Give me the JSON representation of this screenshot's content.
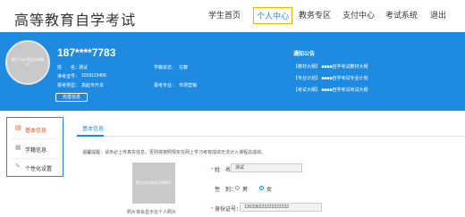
{
  "header": {
    "title": "高等教育自学考试",
    "nav": [
      "学生首页",
      "个人中心",
      "教务专区",
      "支付中心",
      "考试系统",
      "退出"
    ],
    "active_nav": "个人中心"
  },
  "profile": {
    "avatar_placeholder": "图片为必须显示的照片",
    "phone": "187****7783",
    "name_label": "姓　　名：",
    "name_value": "测试",
    "status_label": "学籍状态：",
    "status_value": "在籍",
    "permit_label": "准考证号：",
    "permit_value": "2018123456",
    "level_label": "报考类型：",
    "level_value": "高起专升本",
    "major_label": "报考专业：",
    "major_value": "市场营销",
    "perfect_button": "完善信息"
  },
  "notice": {
    "title": "通知公告",
    "items": [
      "【教材大纲】 ■■■■自学考试教材大纲",
      "【专业计划】 ■■■■自学考试专业计划",
      "【考试大纲】 ■■■■自学考试考试大纲"
    ]
  },
  "sidebar": {
    "items": [
      {
        "icon": "document-icon",
        "glyph": "▤",
        "label": "基本信息"
      },
      {
        "icon": "file-icon",
        "glyph": "▦",
        "label": "学籍信息"
      },
      {
        "icon": "edit-icon",
        "glyph": "✎",
        "label": "个性化设置"
      }
    ]
  },
  "main": {
    "tab": "基本信息",
    "hint": "温馨提醒：请务必上传真实信息，否则将按照规定在网上学习考核成绩无法计入课程总成绩。",
    "photo_placeholder": "图片为必须显示的照片",
    "photo_caption": "照片将会显示在个人照片",
    "fields": {
      "name_label": "姓　名：",
      "name_value": "测试",
      "gender_label": "性　别：",
      "gender_male": "男",
      "gender_female": "女",
      "id_label": "身份证号：",
      "id_value": "130336222222222222"
    }
  },
  "colors": {
    "primary": "#1f8be0",
    "accent": "#e8541e",
    "highlight_border": "#f0b400"
  }
}
